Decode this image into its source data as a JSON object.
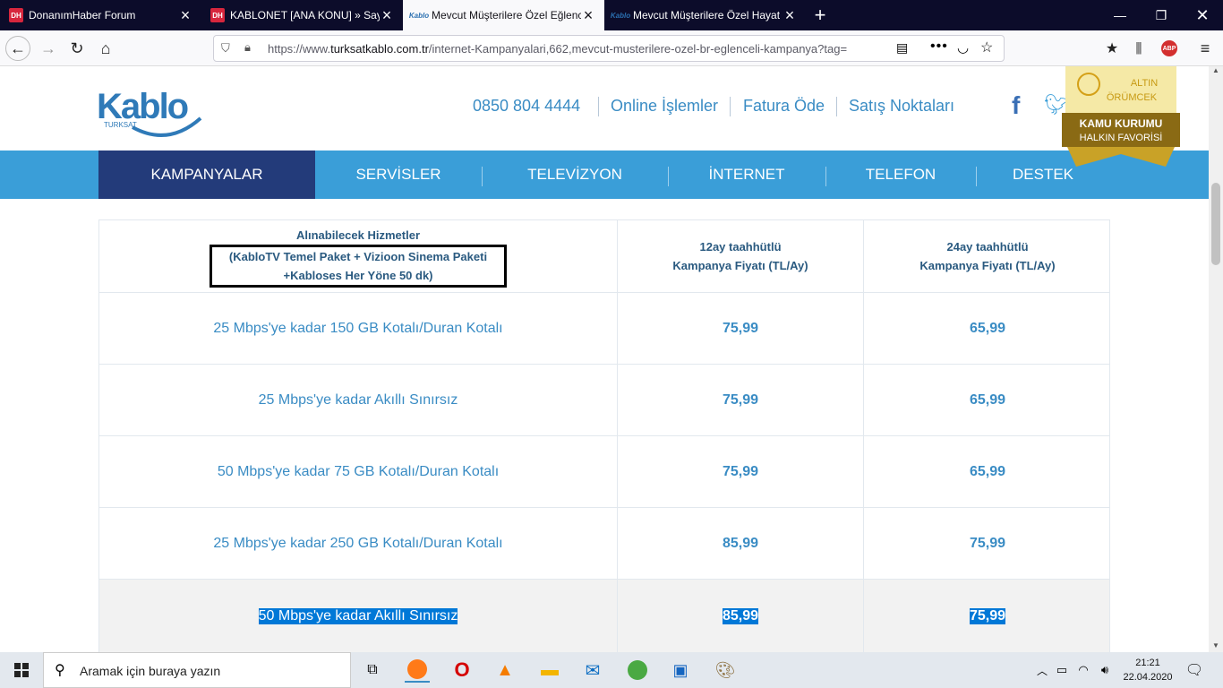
{
  "browser": {
    "tabs": [
      {
        "title": "DonanımHaber Forum",
        "favicon": "DH"
      },
      {
        "title": "KABLONET [ANA KONU] » Sayfa",
        "favicon": "DH"
      },
      {
        "title": "Mevcut Müşterilere Özel Eğlence",
        "favicon": "Kablo"
      },
      {
        "title": "Mevcut Müşterilere Özel Hayat",
        "favicon": "Kablo"
      }
    ],
    "new_tab": "+",
    "url_prefix": "https://www.",
    "url_domain": "turksatkablo.com.tr",
    "url_path": "/internet-Kampanyalari,662,mevcut-musterilere-ozel-br-eglenceli-kampanya?tag=",
    "abp_badge": "ABP"
  },
  "site": {
    "logo_text": "Kablo",
    "logo_sub": "TURKSAT",
    "phone": "0850 804 4444",
    "links": [
      "Online İşlemler",
      "Fatura Öde",
      "Satış Noktaları"
    ],
    "badge_line1": "ALTIN",
    "badge_line2": "ÖRÜMCEK",
    "badge_line3": "KAMU KURUMU",
    "badge_line4": "HALKIN FAVORİSİ",
    "menu": [
      "KAMPANYALAR",
      "SERVİSLER",
      "TELEVİZYON",
      "İNTERNET",
      "TELEFON",
      "DESTEK"
    ]
  },
  "table": {
    "header_col1_title": "Alınabilecek Hizmetler",
    "header_col1_line2": "(KabloTV Temel Paket + Vizioon Sinema Paketi",
    "header_col1_line3": "+Kabloses Her Yöne 50 dk)",
    "header_col2_line1": "12ay taahhütlü",
    "header_col2_line2": "Kampanya Fiyatı (TL/Ay)",
    "header_col3_line1": "24ay taahhütlü",
    "header_col3_line2": "Kampanya Fiyatı (TL/Ay)",
    "rows": [
      {
        "service": "25 Mbps'ye kadar 150 GB Kotalı/Duran Kotalı",
        "p12": "75,99",
        "p24": "65,99"
      },
      {
        "service": "25 Mbps'ye kadar Akıllı Sınırsız",
        "p12": "75,99",
        "p24": "65,99"
      },
      {
        "service": "50 Mbps'ye kadar 75 GB Kotalı/Duran Kotalı",
        "p12": "75,99",
        "p24": "65,99"
      },
      {
        "service": "25 Mbps'ye kadar 250 GB Kotalı/Duran Kotalı",
        "p12": "85,99",
        "p24": "75,99"
      },
      {
        "service": "50 Mbps'ye kadar Akıllı Sınırsız",
        "p12": "85,99",
        "p24": "75,99"
      }
    ]
  },
  "taskbar": {
    "search_placeholder": "Aramak için buraya yazın",
    "time": "21:21",
    "date": "22.04.2020"
  },
  "colors": {
    "accent": "#3a9ed8",
    "menu_active": "#233b7a",
    "link": "#3a8cc4",
    "selection": "#0078d7"
  }
}
